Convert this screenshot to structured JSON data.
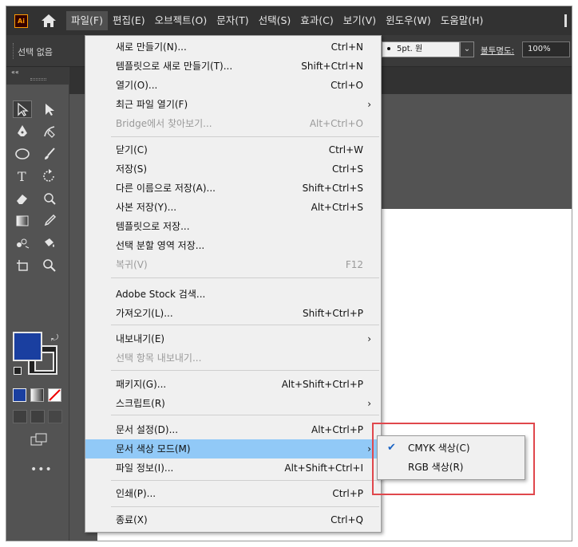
{
  "menubar": {
    "logo_text": "Ai",
    "items": [
      "파일(F)",
      "편집(E)",
      "오브젝트(O)",
      "문자(T)",
      "선택(S)",
      "효과(C)",
      "보기(V)",
      "윈도우(W)",
      "도움말(H)"
    ],
    "active_index": 0
  },
  "controlbar": {
    "selection_status": "선택 없음",
    "stroke_profile": "5pt. 원",
    "opacity_label": "불투명도:",
    "opacity_value": "100%"
  },
  "toolbar": {
    "collapse_label": "««",
    "more_label": "•••",
    "fill_color": "#1a3fa0"
  },
  "file_menu": {
    "items": [
      {
        "label": "새로 만들기(N)...",
        "shortcut": "Ctrl+N",
        "disabled": false
      },
      {
        "label": "템플릿으로 새로 만들기(T)...",
        "shortcut": "Shift+Ctrl+N",
        "disabled": false
      },
      {
        "label": "열기(O)...",
        "shortcut": "Ctrl+O",
        "disabled": false
      },
      {
        "label": "최근 파일 열기(F)",
        "shortcut": "",
        "submenu": true,
        "disabled": false
      },
      {
        "label": "Bridge에서 찾아보기...",
        "shortcut": "Alt+Ctrl+O",
        "disabled": true
      },
      {
        "label": "닫기(C)",
        "shortcut": "Ctrl+W",
        "disabled": false
      },
      {
        "label": "저장(S)",
        "shortcut": "Ctrl+S",
        "disabled": false
      },
      {
        "label": "다른 이름으로 저장(A)...",
        "shortcut": "Shift+Ctrl+S",
        "disabled": false
      },
      {
        "label": "사본 저장(Y)...",
        "shortcut": "Alt+Ctrl+S",
        "disabled": false
      },
      {
        "label": "템플릿으로 저장...",
        "shortcut": "",
        "disabled": false
      },
      {
        "label": "선택 분할 영역 저장...",
        "shortcut": "",
        "disabled": false
      },
      {
        "label": "복귀(V)",
        "shortcut": "F12",
        "disabled": true
      },
      {
        "label": "Adobe Stock 검색...",
        "shortcut": "",
        "disabled": false
      },
      {
        "label": "가져오기(L)...",
        "shortcut": "Shift+Ctrl+P",
        "disabled": false
      },
      {
        "label": "내보내기(E)",
        "shortcut": "",
        "submenu": true,
        "disabled": false
      },
      {
        "label": "선택 항목 내보내기...",
        "shortcut": "",
        "disabled": true
      },
      {
        "label": "패키지(G)...",
        "shortcut": "Alt+Shift+Ctrl+P",
        "disabled": false
      },
      {
        "label": "스크립트(R)",
        "shortcut": "",
        "submenu": true,
        "disabled": false
      },
      {
        "label": "문서 설정(D)...",
        "shortcut": "Alt+Ctrl+P",
        "disabled": false
      },
      {
        "label": "문서 색상 모드(M)",
        "shortcut": "",
        "submenu": true,
        "highlight": true,
        "disabled": false
      },
      {
        "label": "파일 정보(I)...",
        "shortcut": "Alt+Shift+Ctrl+I",
        "disabled": false
      },
      {
        "label": "인쇄(P)...",
        "shortcut": "Ctrl+P",
        "disabled": false
      },
      {
        "label": "종료(X)",
        "shortcut": "Ctrl+Q",
        "disabled": false
      }
    ]
  },
  "color_mode_submenu": {
    "items": [
      {
        "label": "CMYK 색상(C)",
        "checked": true
      },
      {
        "label": "RGB 색상(R)",
        "checked": false
      }
    ]
  },
  "colors": {
    "highlight_box": "#e0474c",
    "menu_highlight": "#91c9f7",
    "accent_orange": "#ff9a00"
  }
}
